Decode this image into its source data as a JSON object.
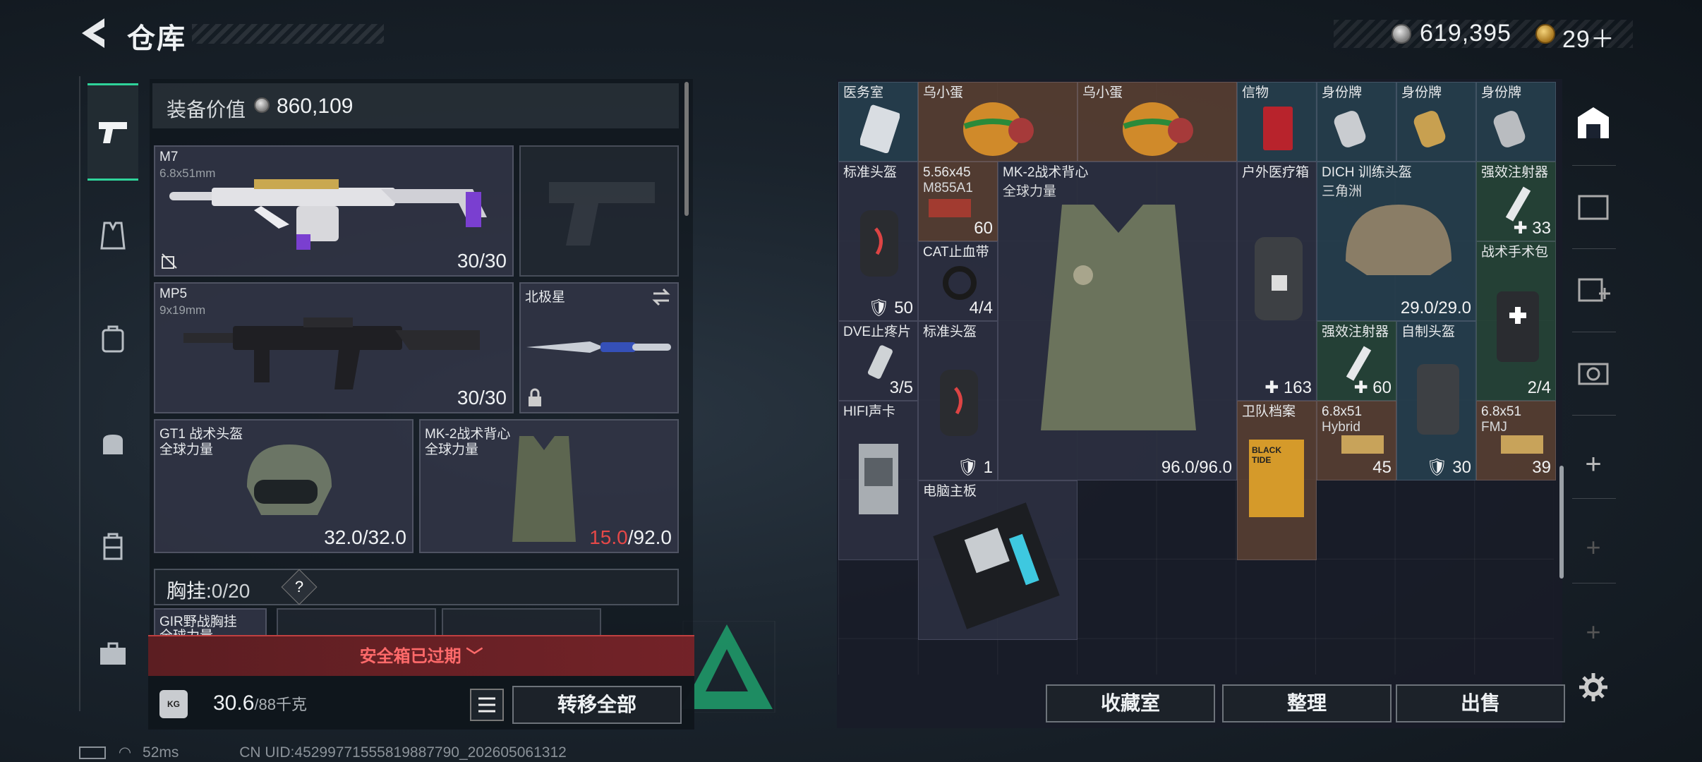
{
  "header": {
    "title": "仓库",
    "silver": "619,395",
    "gold": "29＋"
  },
  "equipment": {
    "value_label": "装备价值",
    "value": "860,109",
    "slots": {
      "m7": {
        "name": "M7",
        "caliber": "6.8x51mm",
        "ammo": "30/30"
      },
      "mp5": {
        "name": "MP5",
        "caliber": "9x19mm",
        "ammo": "30/30"
      },
      "melee": {
        "name": "北极星"
      },
      "helmet": {
        "name": "GT1 战术头盔",
        "sub": "全球力量",
        "dur": "32.0/32.0"
      },
      "vest": {
        "name": "MK-2战术背心",
        "sub": "全球力量",
        "dur_cur": "15.0",
        "dur_max": "/92.0"
      }
    },
    "chest": {
      "label": "胸挂:",
      "value": "0/20",
      "help": "?"
    },
    "chest_item": {
      "name": "GIR野战胸挂",
      "sub": "全球力量"
    },
    "safe_box_expired": "安全箱已过期",
    "weight": "30.6",
    "weight_max": "/88千克",
    "kg_icon": "KG",
    "transfer_all": "转移全部"
  },
  "storage": {
    "items": {
      "clinic": {
        "name": "医务室"
      },
      "egg1": {
        "name": "乌小蛋"
      },
      "egg2": {
        "name": "乌小蛋"
      },
      "letter": {
        "name": "信物"
      },
      "tag1": {
        "name": "身份牌"
      },
      "tag2": {
        "name": "身份牌"
      },
      "tag3": {
        "name": "身份牌"
      },
      "helmet_std1": {
        "name": "标准头盔",
        "q": "50"
      },
      "ammo556": {
        "name": "5.56x45",
        "sub": "M855A1",
        "q": "60"
      },
      "vest": {
        "name": "MK-2战术背心",
        "sub": "全球力量",
        "q": "96.0/96.0"
      },
      "medkit": {
        "name": "户外医疗箱",
        "q": "163"
      },
      "dich": {
        "name": "DICH 训练头盔",
        "sub": "三角洲",
        "q": "29.0/29.0"
      },
      "inj1": {
        "name": "强效注射器",
        "q": "33"
      },
      "cat": {
        "name": "CAT止血带",
        "q": "4/4"
      },
      "surgery": {
        "name": "战术手术包",
        "q": "2/4"
      },
      "dve": {
        "name": "DVE止疼片",
        "q": "3/5"
      },
      "helmet_std2": {
        "name": "标准头盔",
        "q": "1"
      },
      "inj2": {
        "name": "强效注射器",
        "q": "60"
      },
      "helmet_home": {
        "name": "自制头盔",
        "q": "30"
      },
      "hifi": {
        "name": "HIFI声卡"
      },
      "archive": {
        "name": "卫队档案",
        "cover": "BLACK TIDE"
      },
      "hybrid": {
        "name": "6.8x51",
        "sub": "Hybrid",
        "q": "45"
      },
      "fmj": {
        "name": "6.8x51",
        "sub": "FMJ",
        "q": "39"
      },
      "mobo": {
        "name": "电脑主板"
      }
    },
    "buttons": {
      "collection": "收藏室",
      "sort": "整理",
      "sell": "出售"
    }
  },
  "right_nav": {
    "plus": "+"
  },
  "status": {
    "ping": "52ms",
    "uid": "CN UID:4529977155581988​7790_202605061312"
  },
  "colors": {
    "accent": "#2fd39a",
    "warning": "#e54848"
  }
}
